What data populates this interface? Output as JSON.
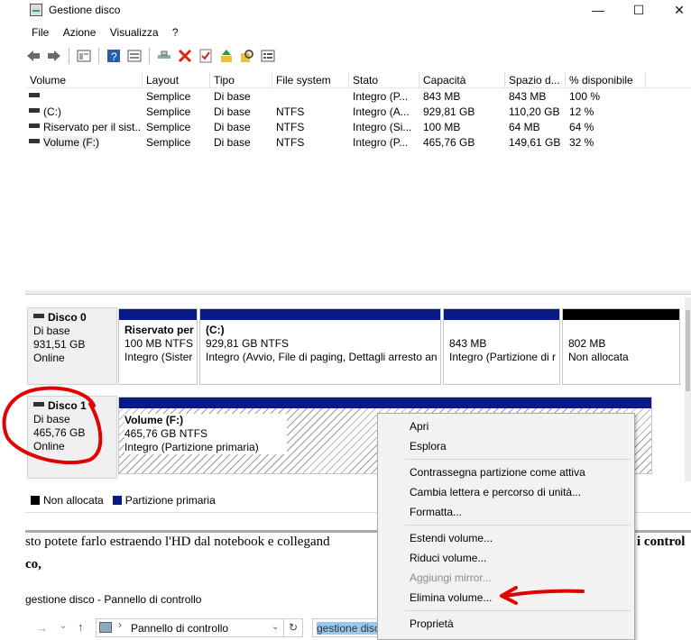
{
  "window": {
    "title": "Gestione disco"
  },
  "menu": [
    "File",
    "Azione",
    "Visualizza",
    "?"
  ],
  "toolbar_icons": [
    "back-arrow-icon",
    "forward-arrow-icon",
    "properties-icon",
    "help-icon",
    "console-icon",
    "connect-icon",
    "delete-icon",
    "check-icon",
    "up-icon",
    "search-icon",
    "list-icon"
  ],
  "volume_table": {
    "columns": [
      "Volume",
      "Layout",
      "Tipo",
      "File system",
      "Stato",
      "Capacità",
      "Spazio d...",
      "% disponibile"
    ],
    "rows": [
      [
        "",
        "Semplice",
        "Di base",
        "",
        "Integro (P...",
        "843 MB",
        "843 MB",
        "100 %"
      ],
      [
        "(C:)",
        "Semplice",
        "Di base",
        "NTFS",
        "Integro (A...",
        "929,81 GB",
        "110,20 GB",
        "12 %"
      ],
      [
        "Riservato per il sist...",
        "Semplice",
        "Di base",
        "NTFS",
        "Integro (Si...",
        "100 MB",
        "64 MB",
        "64 %"
      ],
      [
        "Volume (F:)",
        "Semplice",
        "Di base",
        "NTFS",
        "Integro (P...",
        "465,76 GB",
        "149,61 GB",
        "32 %"
      ]
    ]
  },
  "disk0": {
    "name": "Disco 0",
    "type": "Di base",
    "size": "931,51 GB",
    "status": "Online",
    "partitions": [
      {
        "title": "Riservato per",
        "line2": "100 MB NTFS",
        "line3": "Integro (Sister"
      },
      {
        "title": "(C:)",
        "line2": "929,81 GB NTFS",
        "line3": "Integro (Avvio, File di paging, Dettagli arresto an"
      },
      {
        "title": "",
        "line2": "843 MB",
        "line3": "Integro (Partizione di r"
      },
      {
        "title": "",
        "line2": "802 MB",
        "line3": "Non allocata"
      }
    ]
  },
  "disk1": {
    "name": "Disco 1",
    "type": "Di base",
    "size": "465,76 GB",
    "status": "Online",
    "partition": {
      "title": "Volume  (F:)",
      "line2": "465,76 GB NTFS",
      "line3": "Integro (Partizione primaria)"
    }
  },
  "legend": [
    "Non allocata",
    "Partizione primaria"
  ],
  "legend_colors": {
    "unallocated": "#000000",
    "primary": "#0a1a84"
  },
  "background_page": {
    "line1": "sto potete farlo estraendo l'HD dal notebook e collegand",
    "line1_right": "i control",
    "line2": "co,",
    "caption": "gestione disco - Pannello di controllo",
    "address": "Pannello di controllo",
    "search": "gestione disc"
  },
  "context_menu": {
    "items": [
      "Apri",
      "Esplora",
      "Contrassegna partizione come attiva",
      "Cambia lettera e percorso di unità...",
      "Formatta...",
      "Estendi volume...",
      "Riduci volume...",
      "Aggiungi mirror...",
      "Elimina volume...",
      "Proprietà"
    ]
  },
  "annotation_color": "#e00000"
}
